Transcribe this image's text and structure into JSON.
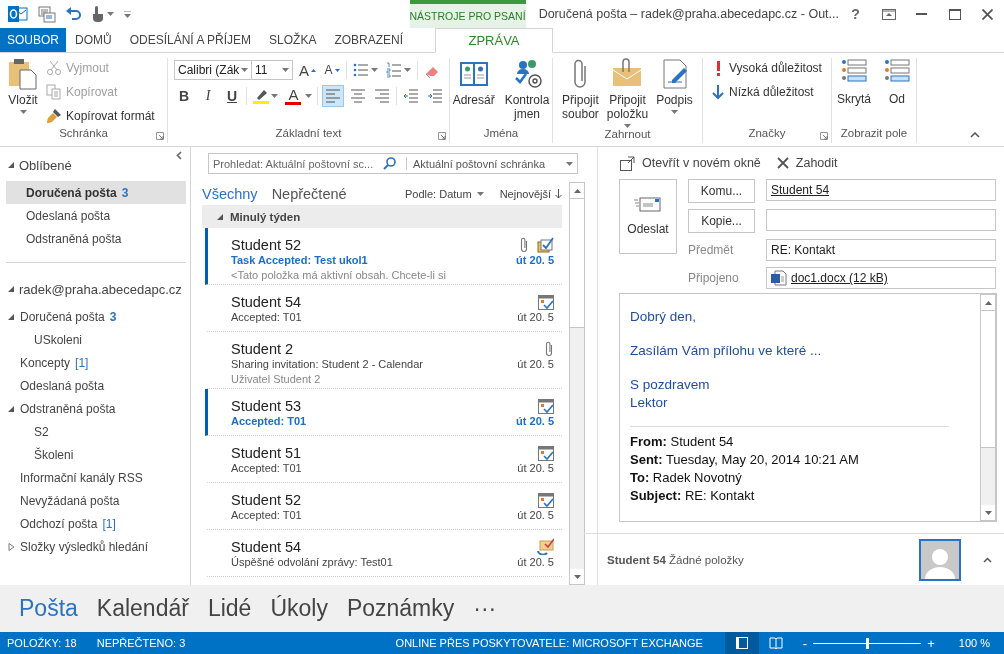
{
  "title_bar": {
    "context_label": "NÁSTROJE PRO PSANÍ",
    "title": "Doručená pošta – radek@praha.abecedapc.cz - Out...",
    "help": "?"
  },
  "tabs": [
    {
      "label": "SOUBOR",
      "kind": "file",
      "selected": false
    },
    {
      "label": "DOMŮ",
      "kind": "normal",
      "selected": false
    },
    {
      "label": "ODESÍLÁNÍ A PŘÍJEM",
      "kind": "normal",
      "selected": false
    },
    {
      "label": "SLOŽKA",
      "kind": "normal",
      "selected": false
    },
    {
      "label": "ZOBRAZENÍ",
      "kind": "normal",
      "selected": false
    },
    {
      "label": "ZPRÁVA",
      "kind": "context",
      "selected": true
    }
  ],
  "ribbon": {
    "clipboard": {
      "label": "Schránka",
      "paste": "Vložit",
      "items": [
        {
          "label": "Vyjmout",
          "disabled": true
        },
        {
          "label": "Kopírovat",
          "disabled": true
        },
        {
          "label": "Kopírovat formát",
          "disabled": false
        }
      ]
    },
    "basic_text": {
      "label": "Základní text",
      "font": "Calibri (Zák",
      "size": "11",
      "grow": "A",
      "shrink": "A",
      "format": [
        "B",
        "I",
        "U"
      ],
      "font_color": "A",
      "align": [
        {
          "selected": true
        },
        {
          "selected": false
        },
        {
          "selected": false
        }
      ]
    },
    "names": {
      "label": "Jména",
      "buttons": [
        "Adresář",
        "Kontrola jmen"
      ]
    },
    "include": {
      "label": "Zahrnout",
      "buttons": [
        {
          "label": "Připojit soubor",
          "menu": false
        },
        {
          "label": "Připojit položku",
          "menu": true
        },
        {
          "label": "Podpis",
          "menu": true
        }
      ]
    },
    "tags": {
      "label": "Značky",
      "items": [
        "Vysoká důležitost",
        "Nízká důležitost"
      ]
    },
    "show_fields": {
      "label": "Zobrazit pole",
      "buttons": [
        "Skrytá",
        "Od"
      ]
    }
  },
  "folders": {
    "favorites": {
      "label": "Oblíbené",
      "expanded": true,
      "items": [
        {
          "label": "Doručená pošta",
          "unread": "3",
          "selected": true
        },
        {
          "label": "Odeslaná pošta",
          "selected": false
        },
        {
          "label": "Odstraněná pošta",
          "selected": false
        }
      ]
    },
    "account": {
      "label": "radek@praha.abecedapc.cz",
      "expanded": true,
      "items": [
        {
          "label": "Doručená pošta",
          "unread": "3",
          "expanded": true,
          "children": [
            {
              "label": "USkoleni"
            }
          ]
        },
        {
          "label": "Koncepty",
          "count": "[1]"
        },
        {
          "label": "Odeslaná pošta"
        },
        {
          "label": "Odstraněná pošta",
          "expanded": true,
          "children": [
            {
              "label": "S2"
            },
            {
              "label": "Školeni"
            }
          ]
        },
        {
          "label": "Informační kanály RSS"
        },
        {
          "label": "Nevyžádaná pošta"
        },
        {
          "label": "Odchozí pošta",
          "count": "[1]"
        },
        {
          "label": "Složky výsledků hledání",
          "expanded": false
        }
      ]
    }
  },
  "message_list": {
    "search": {
      "placeholder": "Prohledat: Aktuální poštovní sc...",
      "scope": "Aktuální poštovní schránka"
    },
    "filters": [
      {
        "label": "Všechny",
        "selected": true
      },
      {
        "label": "Nepřečtené",
        "selected": false
      }
    ],
    "sort": "Podle: Datum",
    "order": "Nejnovější",
    "group": {
      "label": "Minulý týden",
      "expanded": true
    },
    "messages": [
      {
        "sender": "Student 52",
        "subject": "Task Accepted: Test ukol1",
        "preview": "<Tato položka má aktivní obsah. Chcete-li si",
        "date": "út 20. 5",
        "unread": true,
        "attachment": true,
        "kind": "task"
      },
      {
        "sender": "Student 54",
        "subject": "Accepted: T01",
        "date": "út 20. 5",
        "unread": false,
        "attachment": false,
        "kind": "meeting"
      },
      {
        "sender": "Student 2",
        "subject": "Sharing invitation: Student 2 - Calendar",
        "preview": "Uživatel Student 2",
        "date": "út 20. 5",
        "unread": false,
        "attachment": true,
        "kind": "plain"
      },
      {
        "sender": "Student 53",
        "subject": "Accepted: T01",
        "date": "út 20. 5",
        "unread": true,
        "attachment": false,
        "kind": "meeting"
      },
      {
        "sender": "Student 51",
        "subject": "Accepted: T01",
        "date": "út 20. 5",
        "unread": false,
        "attachment": false,
        "kind": "meeting"
      },
      {
        "sender": "Student 52",
        "subject": "Accepted: T01",
        "date": "út 20. 5",
        "unread": false,
        "attachment": false,
        "kind": "meeting"
      },
      {
        "sender": "Student 54",
        "subject": "Úspěšné odvolání zprávy: Test01",
        "date": "út 20. 5",
        "unread": false,
        "attachment": false,
        "kind": "recall"
      }
    ]
  },
  "reading_pane": {
    "commands": [
      "Otevřít v novém okně",
      "Zahodit"
    ],
    "send": "Odeslat",
    "to_button": "Komu...",
    "cc_button": "Kopie...",
    "to": "Student 54",
    "subject_label": "Předmět",
    "subject": "RE: Kontakt",
    "attached_label": "Připojeno",
    "attachment": "doc1.docx (12 kB)",
    "body": [
      [
        "Dobrý den,"
      ],
      [
        "Zasílám Vám přílohu ve které ..."
      ],
      [
        "S pozdravem",
        "Lektor"
      ]
    ],
    "quoted_header": [
      "**From:** Student 54",
      "**Sent:** Tuesday, May 20, 2014 10:21 AM",
      "**To:** Radek Novotný",
      "**Subject:** RE: Kontakt"
    ],
    "people": "**Student 54** Žádné položky"
  },
  "nav": [
    {
      "label": "Pošta",
      "selected": true
    },
    {
      "label": "Kalendář",
      "selected": false
    },
    {
      "label": "Lidé",
      "selected": false
    },
    {
      "label": "Úkoly",
      "selected": false
    },
    {
      "label": "Poznámky",
      "selected": false
    }
  ],
  "nav_more": "···",
  "status_bar": {
    "items": "POLOŽKY: 18",
    "unread": "NEPŘEČTENO: 3",
    "connection": "ONLINE PŘES POSKYTOVATELE: MICROSOFT EXCHANGE",
    "views": [
      {
        "selected": true
      },
      {
        "selected": false
      }
    ],
    "zoom": {
      "minus": "-",
      "plus": "+",
      "level": 0.5,
      "value": "100 %"
    }
  }
}
